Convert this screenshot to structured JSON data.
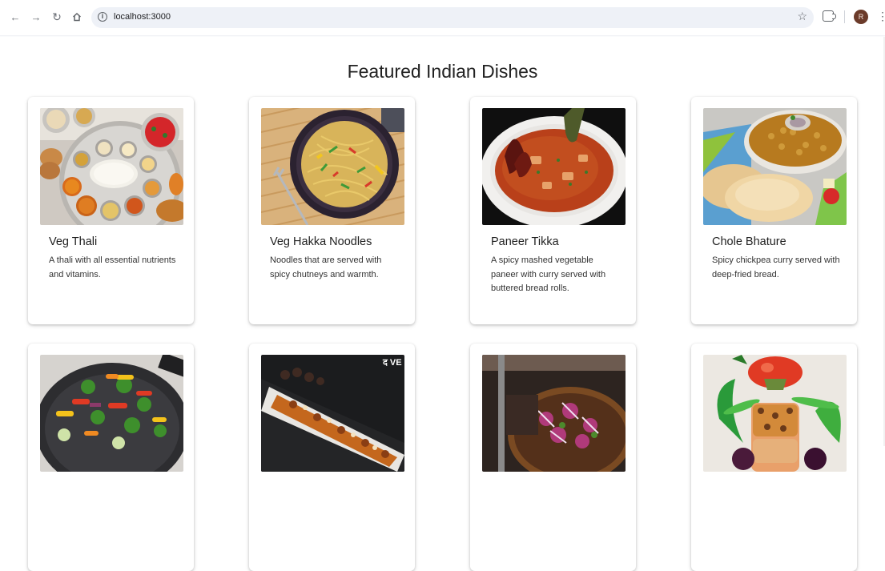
{
  "browser": {
    "url": "localhost:3000",
    "avatar_letter": "R"
  },
  "page": {
    "title": "Featured Indian Dishes"
  },
  "dishes": [
    {
      "name": "Veg Thali",
      "description": "A thali with all essential nutrients and vitamins."
    },
    {
      "name": "Veg Hakka Noodles",
      "description": "Noodles that are served with spicy chutneys and warmth."
    },
    {
      "name": "Paneer Tikka",
      "description": "A spicy mashed vegetable paneer with curry served with buttered bread rolls."
    },
    {
      "name": "Chole Bhature",
      "description": "Spicy chickpea curry served with deep-fried bread."
    },
    {
      "name": "",
      "description": ""
    },
    {
      "name": "",
      "description": ""
    },
    {
      "name": "",
      "description": ""
    },
    {
      "name": "",
      "description": ""
    }
  ],
  "watermark_text": "द VE"
}
